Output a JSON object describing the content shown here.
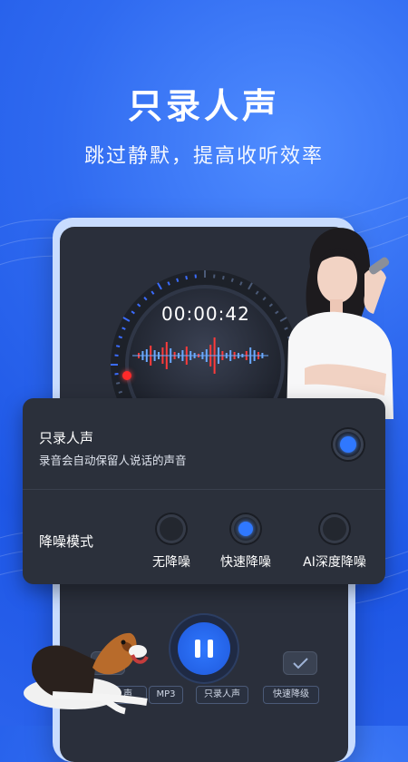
{
  "hero": {
    "title": "只录人声",
    "subtitle": "跳过静默，提高收听效率"
  },
  "recorder": {
    "timer": "00:00:42",
    "icons": [
      "record-dot-icon",
      "waveform-icon"
    ]
  },
  "voice_only": {
    "title": "只录人声",
    "description": "录音会自动保留人说话的声音",
    "enabled": true
  },
  "noise_mode": {
    "label": "降噪模式",
    "options": [
      "无降噪",
      "快速降噪",
      "AI深度降噪"
    ],
    "selected_index": 1
  },
  "controls": {
    "icons": [
      "close-icon",
      "pause-icon",
      "check-icon"
    ],
    "chips": [
      "MP3",
      "只录人声",
      "快速降级"
    ],
    "partial_chip": "声"
  },
  "colors": {
    "accent": "#2f78ff",
    "background": "#2a62ec",
    "card": "#2b303b"
  }
}
